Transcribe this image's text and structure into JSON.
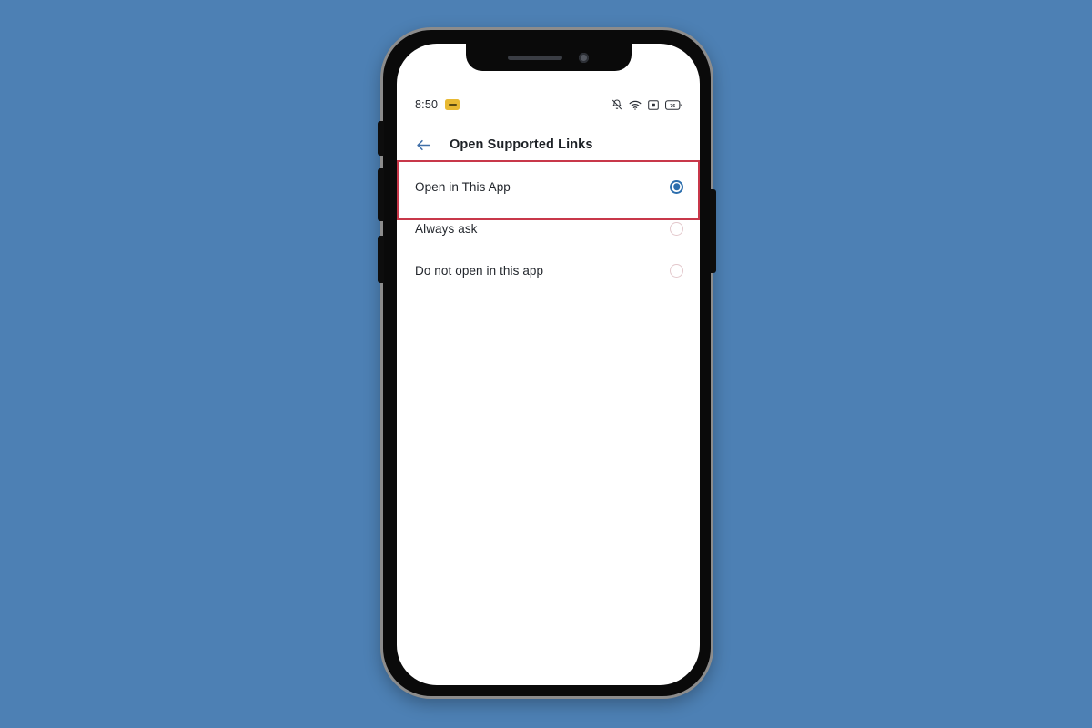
{
  "background": {
    "color": "#4d80b4"
  },
  "device": {
    "name": "smartphone-mockup",
    "frame_color": "#0a0a0a",
    "bezel_color": "#8c8c8c",
    "buttons": [
      {
        "name": "silent-switch",
        "side": "left"
      },
      {
        "name": "volume-up-button",
        "side": "left"
      },
      {
        "name": "volume-down-button",
        "side": "left"
      },
      {
        "name": "power-button",
        "side": "right"
      }
    ]
  },
  "status_bar": {
    "clock": "8:50",
    "notification_icon": "note-chip-icon",
    "icons": [
      {
        "name": "notifications-silenced-icon"
      },
      {
        "name": "wifi-icon"
      },
      {
        "name": "screen-cast-icon"
      },
      {
        "name": "battery-icon",
        "label": "76"
      }
    ]
  },
  "app_bar": {
    "back_icon": "arrow-left-icon",
    "title": "Open Supported Links"
  },
  "options": {
    "items": [
      {
        "label": "Open in This App",
        "selected": true
      },
      {
        "label": "Always ask",
        "selected": false
      },
      {
        "label": "Do not open in this app",
        "selected": false
      }
    ]
  },
  "highlight": {
    "name": "selected-option-highlight",
    "color": "#c8384a",
    "targets_label": "Open in This App"
  },
  "colors": {
    "accent": "#2c6ead",
    "highlight": "#c8384a",
    "notification_chip": "#e8b933",
    "text_primary": "#22262c"
  }
}
